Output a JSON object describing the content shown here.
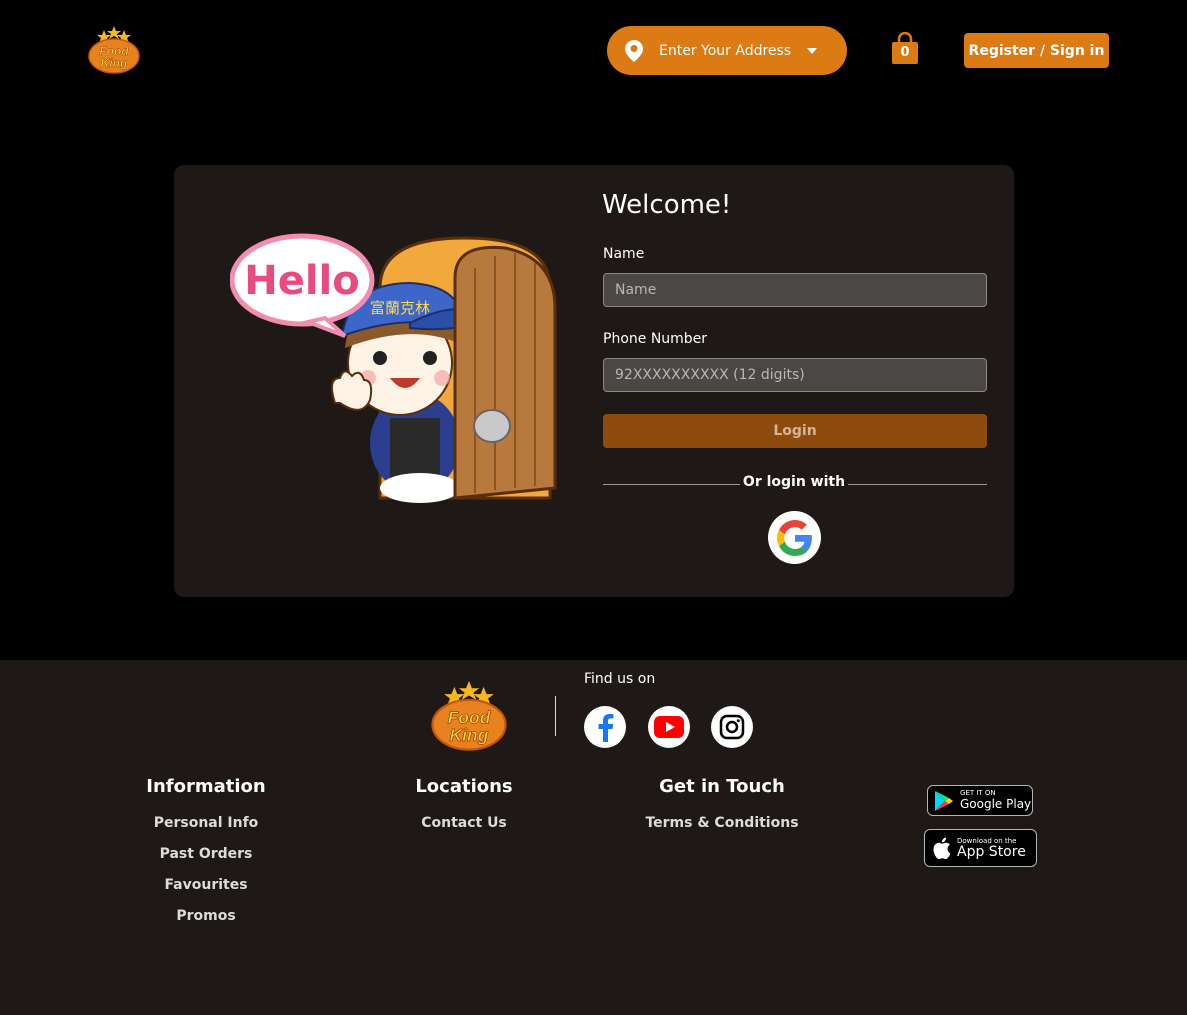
{
  "header": {
    "logo_text": "Food King",
    "address_placeholder": "Enter Your Address",
    "cart_count": "0",
    "register_label": "Register / Sign in"
  },
  "login": {
    "title": "Welcome!",
    "name_label": "Name",
    "name_placeholder": "Name",
    "phone_label": "Phone Number",
    "phone_placeholder": "92XXXXXXXXXX (12 digits)",
    "login_button": "Login",
    "or_login_with": "Or login with",
    "mascot_bubble": "Hello",
    "mascot_cap_text": "富蘭克林"
  },
  "footer": {
    "logo_text": "Food King",
    "find_us": "Find us on",
    "columns": [
      {
        "title": "Information",
        "links": [
          "Personal Info",
          "Past Orders",
          "Favourites",
          "Promos"
        ]
      },
      {
        "title": "Locations",
        "links": [
          "Contact Us"
        ]
      },
      {
        "title": "Get in Touch",
        "links": [
          "Terms & Conditions"
        ]
      }
    ],
    "google_play": {
      "small": "GET IT ON",
      "big": "Google Play"
    },
    "app_store": {
      "small": "Download on the",
      "big": "App Store"
    }
  },
  "colors": {
    "brand_orange": "#dc7a14",
    "login_button": "#8e4b0d",
    "card_bg": "#1e1917",
    "page_bg": "#000000"
  }
}
